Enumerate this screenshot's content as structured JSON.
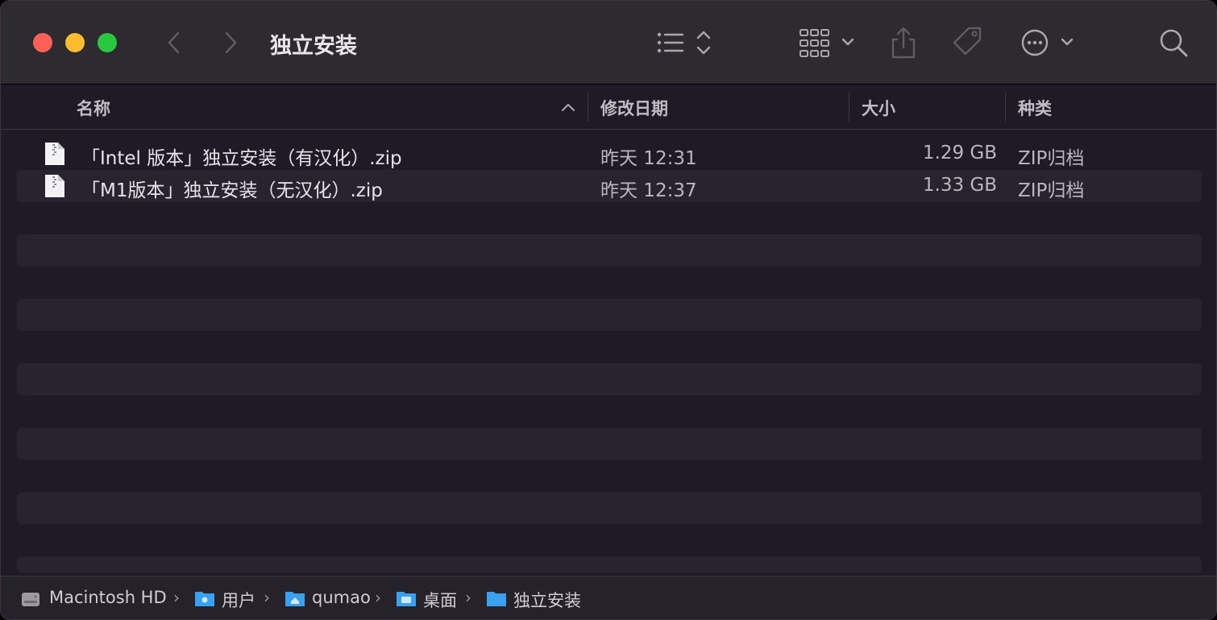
{
  "window": {
    "title": "独立安装"
  },
  "columns": {
    "name": "名称",
    "date": "修改日期",
    "size": "大小",
    "kind": "种类"
  },
  "files": [
    {
      "name": "「Intel 版本」独立安装（有汉化）.zip",
      "date": "昨天 12:31",
      "size": "1.29 GB",
      "kind": "ZIP归档"
    },
    {
      "name": "「M1版本」独立安装（无汉化）.zip",
      "date": "昨天 12:37",
      "size": "1.33 GB",
      "kind": "ZIP归档"
    }
  ],
  "path": [
    "Macintosh HD",
    "用户",
    "qumao",
    "桌面",
    "独立安装"
  ],
  "colors": {
    "close": "#fe5f57",
    "minimize": "#febc2e",
    "zoom": "#28c840",
    "folder": "#3aa0f0",
    "background": "#1e1a26"
  },
  "icons": [
    "chevron-left-icon",
    "chevron-right-icon",
    "list-view-icon",
    "sort-arrows-icon",
    "group-grid-icon",
    "share-icon",
    "tag-icon",
    "more-icon",
    "search-icon",
    "zip-file-icon",
    "disk-icon",
    "folder-icon"
  ]
}
